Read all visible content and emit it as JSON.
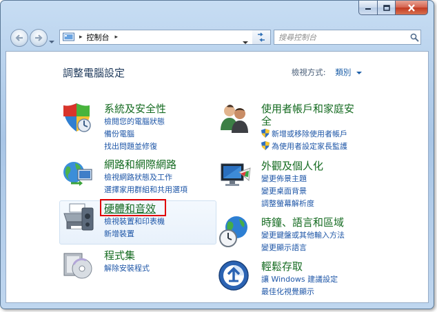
{
  "window": {
    "controls": {
      "minimize": "minimize-icon",
      "maximize": "maximize-icon",
      "close": "close-icon"
    }
  },
  "nav": {
    "address": {
      "icon": "control-panel-icon",
      "sep1": "▸",
      "location": "控制台",
      "sep2": "▸"
    },
    "search": {
      "placeholder": "搜尋控制台"
    }
  },
  "page": {
    "title": "調整電腦設定",
    "view_by_label": "檢視方式:",
    "view_by_value": "類別"
  },
  "categories": {
    "system": {
      "title": "系統及安全性",
      "links": [
        "檢閱您的電腦狀態",
        "備份電腦",
        "找出問題並修復"
      ]
    },
    "network": {
      "title": "網路和網際網路",
      "links": [
        "檢視網路狀態及工作",
        "選擇家用群組和共用選項"
      ]
    },
    "hardware": {
      "title": "硬體和音效",
      "links": [
        "檢視裝置和印表機",
        "新增裝置"
      ]
    },
    "programs": {
      "title": "程式集",
      "links": [
        "解除安裝程式"
      ]
    },
    "users": {
      "title_line1": "使用者帳戶和家庭安",
      "title_line2": "全",
      "links": [
        "新增或移除使用者帳戶",
        "為使用者設定家長監護"
      ]
    },
    "appearance": {
      "title": "外觀及個人化",
      "links": [
        "變更佈景主題",
        "變更桌面背景",
        "調整螢幕解析度"
      ]
    },
    "clock": {
      "title": "時鐘、語言和區域",
      "links": [
        "變更鍵盤或其他輸入方法",
        "變更顯示語言"
      ]
    },
    "access": {
      "title": "輕鬆存取",
      "links": [
        "讓 Windows 建議設定",
        "最佳化視覺顯示"
      ]
    }
  },
  "colors": {
    "category_title": "#156b21",
    "link": "#1e56a7",
    "highlight_box": "#e00000"
  }
}
